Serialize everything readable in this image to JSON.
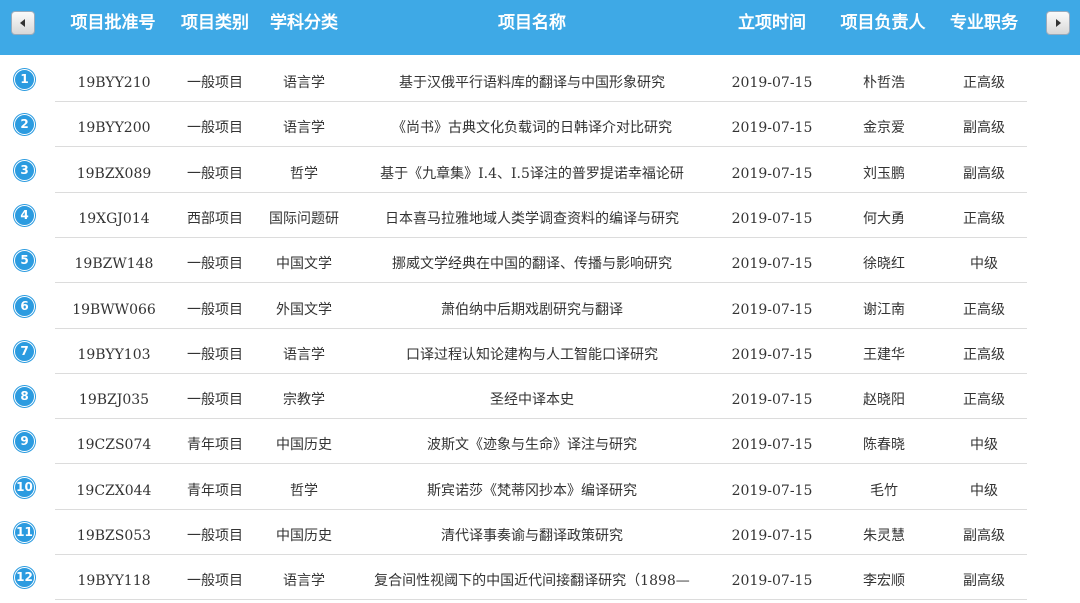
{
  "header": {
    "columns": [
      "项目批准号",
      "项目类别",
      "学科分类",
      "项目名称",
      "立项时间",
      "项目负责人",
      "专业职务"
    ],
    "prev_icon": "chevron-left-icon",
    "next_icon": "chevron-right-icon"
  },
  "rows": [
    {
      "num": "1",
      "code": "19BYY210",
      "type": "一般项目",
      "subject": "语言学",
      "name": "基于汉俄平行语料库的翻译与中国形象研究",
      "date": "2019-07-15",
      "leader": "朴哲浩",
      "rank": "正高级"
    },
    {
      "num": "2",
      "code": "19BYY200",
      "type": "一般项目",
      "subject": "语言学",
      "name": "《尚书》古典文化负载词的日韩译介对比研究",
      "date": "2019-07-15",
      "leader": "金京爱",
      "rank": "副高级"
    },
    {
      "num": "3",
      "code": "19BZX089",
      "type": "一般项目",
      "subject": "哲学",
      "name": "基于《九章集》I.4、I.5译注的普罗提诺幸福论研",
      "date": "2019-07-15",
      "leader": "刘玉鹏",
      "rank": "副高级"
    },
    {
      "num": "4",
      "code": "19XGJ014",
      "type": "西部项目",
      "subject": "国际问题研",
      "name": "日本喜马拉雅地域人类学调查资料的编译与研究",
      "date": "2019-07-15",
      "leader": "何大勇",
      "rank": "正高级"
    },
    {
      "num": "5",
      "code": "19BZW148",
      "type": "一般项目",
      "subject": "中国文学",
      "name": "挪威文学经典在中国的翻译、传播与影响研究",
      "date": "2019-07-15",
      "leader": "徐晓红",
      "rank": "中级"
    },
    {
      "num": "6",
      "code": "19BWW066",
      "type": "一般项目",
      "subject": "外国文学",
      "name": "萧伯纳中后期戏剧研究与翻译",
      "date": "2019-07-15",
      "leader": "谢江南",
      "rank": "正高级"
    },
    {
      "num": "7",
      "code": "19BYY103",
      "type": "一般项目",
      "subject": "语言学",
      "name": "口译过程认知论建构与人工智能口译研究",
      "date": "2019-07-15",
      "leader": "王建华",
      "rank": "正高级"
    },
    {
      "num": "8",
      "code": "19BZJ035",
      "type": "一般项目",
      "subject": "宗教学",
      "name": "圣经中译本史",
      "date": "2019-07-15",
      "leader": "赵晓阳",
      "rank": "正高级"
    },
    {
      "num": "9",
      "code": "19CZS074",
      "type": "青年项目",
      "subject": "中国历史",
      "name": "波斯文《迹象与生命》译注与研究",
      "date": "2019-07-15",
      "leader": "陈春晓",
      "rank": "中级"
    },
    {
      "num": "10",
      "code": "19CZX044",
      "type": "青年项目",
      "subject": "哲学",
      "name": "斯宾诺莎《梵蒂冈抄本》编译研究",
      "date": "2019-07-15",
      "leader": "毛竹",
      "rank": "中级"
    },
    {
      "num": "11",
      "code": "19BZS053",
      "type": "一般项目",
      "subject": "中国历史",
      "name": "清代译事奏谕与翻译政策研究",
      "date": "2019-07-15",
      "leader": "朱灵慧",
      "rank": "副高级"
    },
    {
      "num": "12",
      "code": "19BYY118",
      "type": "一般项目",
      "subject": "语言学",
      "name": "复合间性视阈下的中国近代间接翻译研究（1898—",
      "date": "2019-07-15",
      "leader": "李宏顺",
      "rank": "副高级"
    }
  ],
  "colors": {
    "header_bg": "#3ea9e6",
    "badge": "#2b9be0",
    "text": "#333333"
  }
}
